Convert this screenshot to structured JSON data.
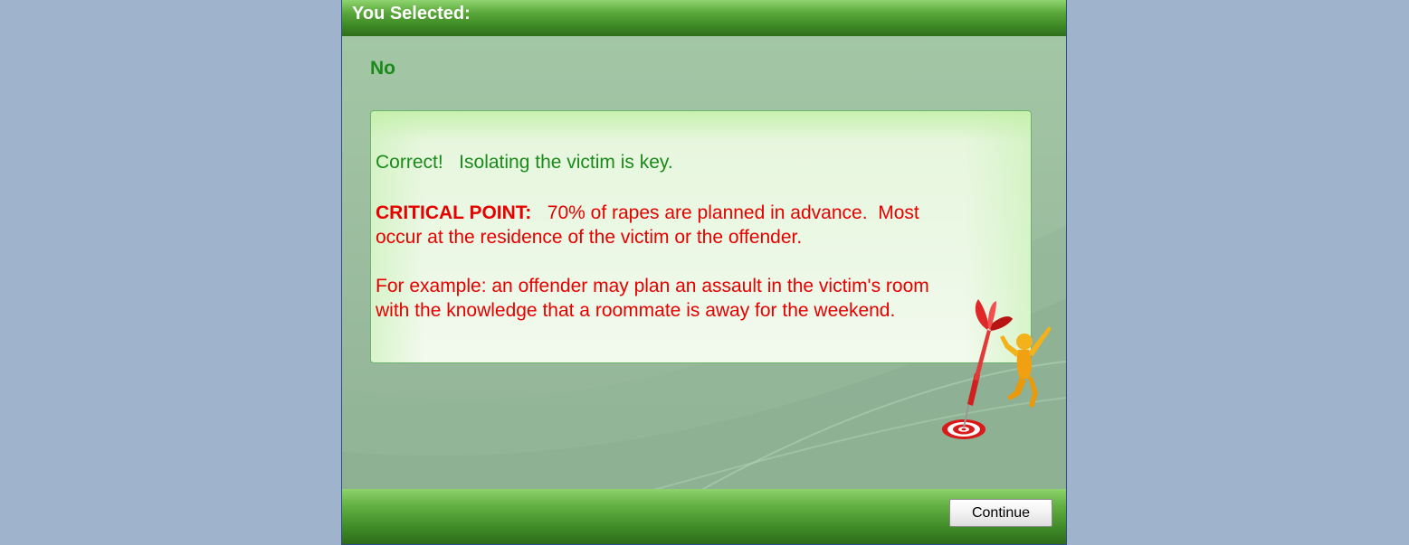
{
  "dialog": {
    "title": "You Selected:",
    "selected_answer": "No"
  },
  "feedback": {
    "correct_text": "Correct!   Isolating the victim is key.",
    "critical_label": "CRITICAL POINT:",
    "critical_text_line1": "   70% of rapes are planned in advance.  Most",
    "critical_text_line2": "occur at the residence of the victim or the offender.",
    "example_line1": "For example: an offender may plan an assault in the victim's room",
    "example_line2": "with the knowledge that a roommate is away for the weekend."
  },
  "footer": {
    "continue_label": "Continue"
  },
  "colors": {
    "page_background": "#9fb4cc",
    "header_green": "#3e8a25",
    "correct_text": "#1a8a1a",
    "critical_text": "#e60000"
  },
  "icons": {
    "illustration": "dart-target-cheering-figure"
  }
}
